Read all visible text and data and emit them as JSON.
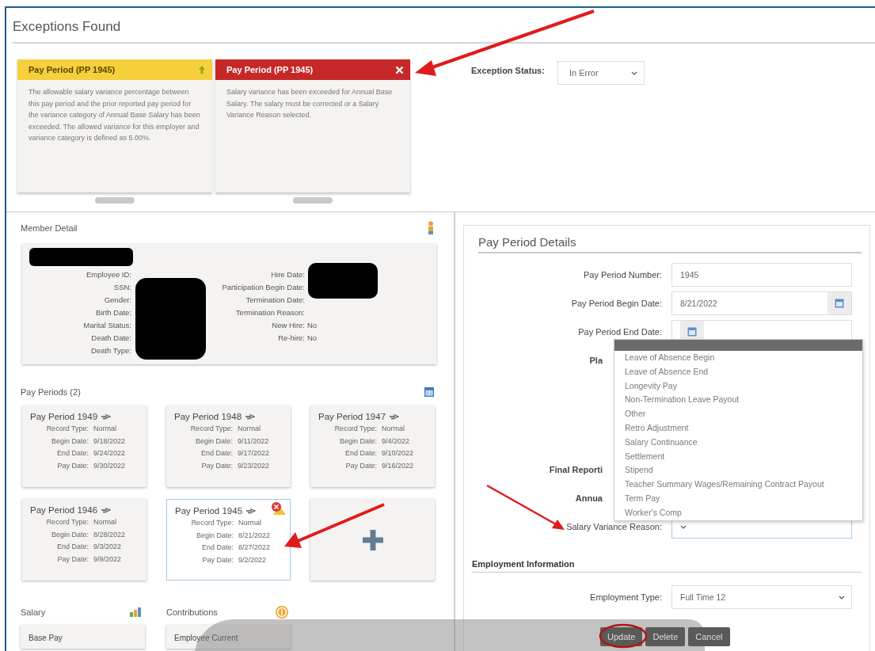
{
  "exceptions": {
    "title": "Exceptions Found",
    "cards": [
      {
        "kind": "warning",
        "title": "Pay Period (PP 1945)",
        "text": "The allowable salary variance percentage between this pay period and the prior reported pay period for the variance category of Annual Base Salary has been exceeded. The allowed variance for this employer and variance category is defined as 5.00%."
      },
      {
        "kind": "error",
        "title": "Pay Period (PP 1945)",
        "text": "Salary variance has been exceeded for Annual Base Salary. The salary must be corrected or a Salary Variance Reason selected."
      }
    ],
    "status": {
      "label": "Exception Status:",
      "value": "In Error"
    }
  },
  "member_detail": {
    "title": "Member Detail",
    "left_fields": [
      {
        "label": "Employee ID:"
      },
      {
        "label": "SSN:"
      },
      {
        "label": "Gender:"
      },
      {
        "label": "Birth Date:"
      },
      {
        "label": "Marital Status:"
      },
      {
        "label": "Death Date:"
      },
      {
        "label": "Death Type:"
      }
    ],
    "right_fields": [
      {
        "label": "Hire Date:"
      },
      {
        "label": "Participation Begin Date:"
      },
      {
        "label": "Termination Date:"
      },
      {
        "label": "Termination Reason:"
      },
      {
        "label": "New Hire:",
        "value": "No"
      },
      {
        "label": "Re-hire:",
        "value": "No"
      }
    ]
  },
  "pay_periods": {
    "title": "Pay Periods (2)",
    "cards": [
      {
        "kind": "period",
        "title": "Pay Period 1949",
        "selected": false,
        "exception": false,
        "fields": [
          {
            "label": "Record Type:",
            "value": "Normal"
          },
          {
            "label": "Begin Date:",
            "value": "9/18/2022"
          },
          {
            "label": "End Date:",
            "value": "9/24/2022"
          },
          {
            "label": "Pay Date:",
            "value": "9/30/2022"
          }
        ]
      },
      {
        "kind": "period",
        "title": "Pay Period 1948",
        "selected": false,
        "exception": false,
        "fields": [
          {
            "label": "Record Type:",
            "value": "Normal"
          },
          {
            "label": "Begin Date:",
            "value": "9/11/2022"
          },
          {
            "label": "End Date:",
            "value": "9/17/2022"
          },
          {
            "label": "Pay Date:",
            "value": "9/23/2022"
          }
        ]
      },
      {
        "kind": "period",
        "title": "Pay Period 1947",
        "selected": false,
        "exception": false,
        "fields": [
          {
            "label": "Record Type:",
            "value": "Normal"
          },
          {
            "label": "Begin Date:",
            "value": "9/4/2022"
          },
          {
            "label": "End Date:",
            "value": "9/10/2022"
          },
          {
            "label": "Pay Date:",
            "value": "9/16/2022"
          }
        ]
      },
      {
        "kind": "period",
        "title": "Pay Period 1946",
        "selected": false,
        "exception": false,
        "fields": [
          {
            "label": "Record Type:",
            "value": "Normal"
          },
          {
            "label": "Begin Date:",
            "value": "8/28/2022"
          },
          {
            "label": "End Date:",
            "value": "9/3/2022"
          },
          {
            "label": "Pay Date:",
            "value": "9/9/2022"
          }
        ]
      },
      {
        "kind": "period",
        "title": "Pay Period 1945",
        "selected": true,
        "exception": true,
        "fields": [
          {
            "label": "Record Type:",
            "value": "Normal"
          },
          {
            "label": "Begin Date:",
            "value": "8/21/2022"
          },
          {
            "label": "End Date:",
            "value": "8/27/2022"
          },
          {
            "label": "Pay Date:",
            "value": "9/2/2022"
          }
        ]
      },
      {
        "kind": "add"
      }
    ]
  },
  "salary": {
    "title": "Salary",
    "card_title": "Base Pay"
  },
  "contributions": {
    "title": "Contributions",
    "card_title": "Employee Current"
  },
  "pay_period_details": {
    "title": "Pay Period Details",
    "rows": [
      {
        "kind": "text",
        "label": "Pay Period Number:",
        "value": "1945"
      },
      {
        "kind": "date",
        "label": "Pay Period Begin Date:",
        "value": "8/21/2022"
      },
      {
        "kind": "date",
        "label": "Pay Period End Date:"
      },
      {
        "kind": "covered",
        "label": "Pla"
      },
      {
        "kind": "covered",
        "label": "Final Reporti"
      },
      {
        "kind": "covered",
        "label": "Annua"
      },
      {
        "kind": "select",
        "label": "Salary Variance Reason:",
        "focused": true
      }
    ]
  },
  "reason_dropdown": {
    "options": [
      "Leave of Absence Begin",
      "Leave of Absence End",
      "Longevity Pay",
      "Non-Termination Leave Payout",
      "Other",
      "Retro Adjustment",
      "Salary Continuance",
      "Settlement",
      "Stipend",
      "Teacher Summary Wages/Remaining Contract Payout",
      "Term Pay",
      "Worker's Comp"
    ]
  },
  "employment": {
    "title": "Employment Information",
    "rows": [
      {
        "kind": "select",
        "label": "Employment Type:",
        "value": "Full Time 12",
        "focused": false
      }
    ]
  },
  "actions": [
    {
      "label": "Update"
    },
    {
      "label": "Delete"
    },
    {
      "label": "Cancel"
    }
  ]
}
